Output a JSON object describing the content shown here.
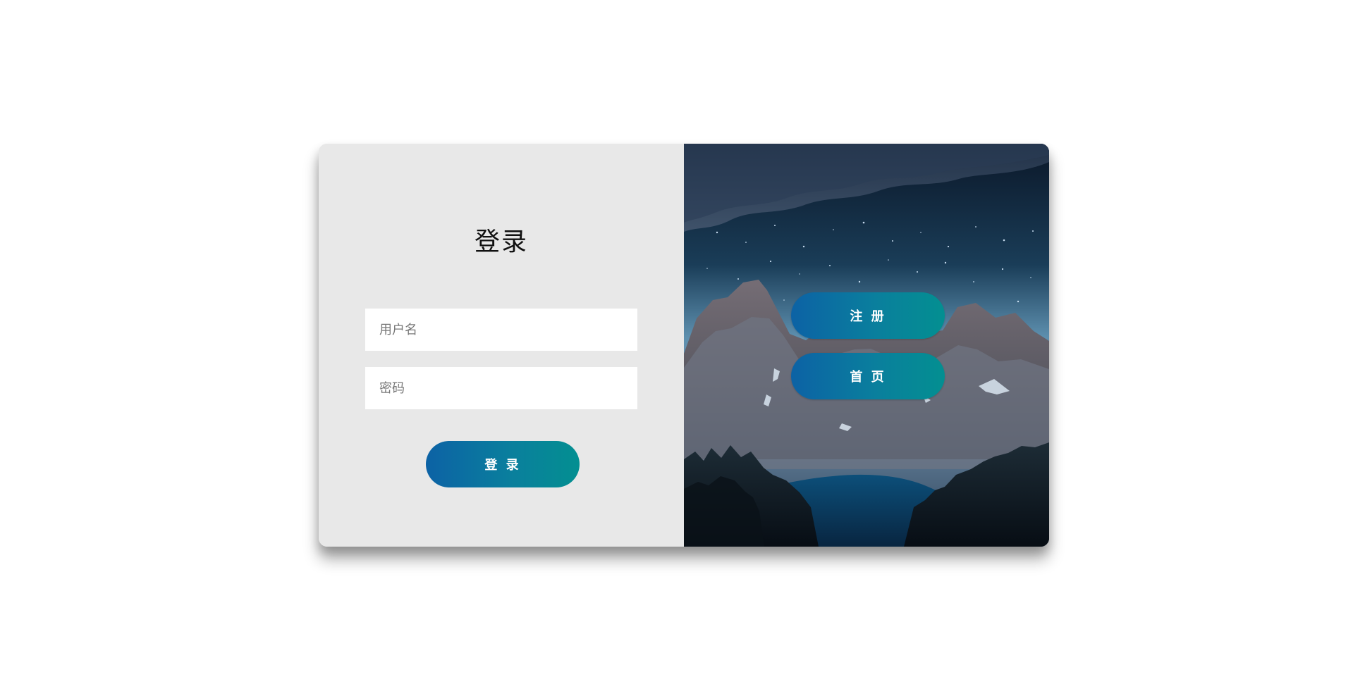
{
  "login": {
    "title": "登录",
    "username_placeholder": "用户名",
    "password_placeholder": "密码",
    "login_button": "登 录"
  },
  "side_panel": {
    "register_button": "注 册",
    "home_button": "首 页"
  },
  "colors": {
    "button_gradient_start": "#0c62a5",
    "button_gradient_end": "#038f91",
    "left_panel_bg": "#e8e8e8",
    "page_bg": "#ffffff"
  }
}
